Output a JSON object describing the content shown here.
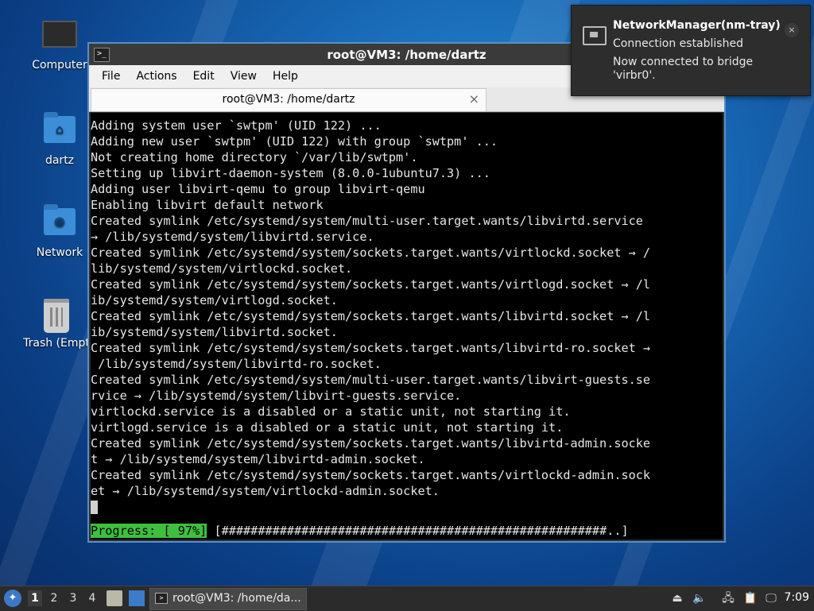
{
  "desktop": {
    "icons": [
      {
        "label": "Computer",
        "icon": "computer-icon"
      },
      {
        "label": "dartz",
        "icon": "home-folder-icon"
      },
      {
        "label": "Network",
        "icon": "network-folder-icon"
      },
      {
        "label": "Trash (Empt",
        "icon": "trash-icon"
      }
    ]
  },
  "notification": {
    "title": "NetworkManager(nm-tray)",
    "subtitle": "Connection established",
    "body": "Now connected to bridge 'virbr0'.",
    "close": "×",
    "icon": "network-wired-icon"
  },
  "window": {
    "title": "root@VM3: /home/dartz",
    "menu": [
      "File",
      "Actions",
      "Edit",
      "View",
      "Help"
    ],
    "tab": {
      "label": "root@VM3: /home/dartz",
      "close": "×"
    },
    "terminal_lines": [
      "Adding system user `swtpm' (UID 122) ...",
      "Adding new user `swtpm' (UID 122) with group `swtpm' ...",
      "Not creating home directory `/var/lib/swtpm'.",
      "Setting up libvirt-daemon-system (8.0.0-1ubuntu7.3) ...",
      "Adding user libvirt-qemu to group libvirt-qemu",
      "Enabling libvirt default network",
      "Created symlink /etc/systemd/system/multi-user.target.wants/libvirtd.service",
      "→ /lib/systemd/system/libvirtd.service.",
      "Created symlink /etc/systemd/system/sockets.target.wants/virtlockd.socket → /",
      "lib/systemd/system/virtlockd.socket.",
      "Created symlink /etc/systemd/system/sockets.target.wants/virtlogd.socket → /l",
      "ib/systemd/system/virtlogd.socket.",
      "Created symlink /etc/systemd/system/sockets.target.wants/libvirtd.socket → /l",
      "ib/systemd/system/libvirtd.socket.",
      "Created symlink /etc/systemd/system/sockets.target.wants/libvirtd-ro.socket →",
      " /lib/systemd/system/libvirtd-ro.socket.",
      "Created symlink /etc/systemd/system/multi-user.target.wants/libvirt-guests.se",
      "rvice → /lib/systemd/system/libvirt-guests.service.",
      "virtlockd.service is a disabled or a static unit, not starting it.",
      "virtlogd.service is a disabled or a static unit, not starting it.",
      "Created symlink /etc/systemd/system/sockets.target.wants/libvirtd-admin.socke",
      "t → /lib/systemd/system/libvirtd-admin.socket.",
      "Created symlink /etc/systemd/system/sockets.target.wants/virtlockd-admin.sock",
      "et → /lib/systemd/system/virtlockd-admin.socket."
    ],
    "progress_label": "Progress: [ 97%]",
    "progress_bar": " [#####################################################..]",
    "progress_value": 0.97
  },
  "taskbar": {
    "workspaces": [
      "1",
      "2",
      "3",
      "4"
    ],
    "active_workspace": 0,
    "task_label": "root@VM3: /home/da...",
    "clock": "7:09",
    "tray_icons": [
      "eject-icon",
      "volume-icon",
      "network-icon",
      "clipboard-icon",
      "update-notifier-icon"
    ]
  },
  "colors": {
    "accent": "#3b79c6",
    "progress_green": "#3ec03e",
    "terminal_bg": "#000000"
  }
}
